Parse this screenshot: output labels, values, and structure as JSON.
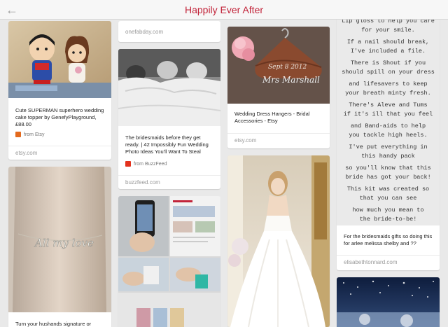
{
  "header": {
    "back_icon": "←",
    "title": "Happily Ever After"
  },
  "colors": {
    "accent": "#c2243a",
    "etsy": "#e36a1e",
    "buzzfeed": "#e3321e"
  },
  "pins": {
    "superman": {
      "description": "Cute SUPERMAN superhero wedding cake topper  by GenefyPlayground, £88.00",
      "via": "from Etsy",
      "domain": "etsy.com"
    },
    "bracelet": {
      "description": "Turn your hushands signature or",
      "script": "All my love"
    },
    "onefabday": {
      "domain": "onefabday.com"
    },
    "bridesmaids": {
      "description": "The bridesmaids before they get ready. | 42 Impossibly Fun Wedding Photo Ideas You'll Want To Steal",
      "via": "from BuzzFeed",
      "domain": "buzzfeed.com"
    },
    "hanger": {
      "date_text": "Sept 8 2012",
      "name_text": "Mrs Marshall",
      "description": "Wedding Dress Hangers - Bridal Accessories - Etsy",
      "domain": "etsy.com"
    },
    "poem": {
      "lines": [
        "Lip gloss to help you care",
        "for your smile.",
        "If a nail should break,",
        "I've included a file.",
        "There is Shout if you",
        "should spill on your dress",
        "and lifesavers to keep",
        "your breath minty fresh.",
        "There's Aleve and Tums",
        "if it's ill that you feel",
        "and Band-aids to help",
        "you tackle high heels.",
        "I've put everything in",
        "this handy pack",
        "so you'll know that this",
        "bride has got your back!",
        "This kit was created so",
        "that you can see",
        "how much you mean to",
        "the bride-to-be!"
      ],
      "description": "For the bridesmaids gifts so doing this for arlee melissa shelby and ??",
      "domain": "elisabethtonnard.com"
    }
  }
}
